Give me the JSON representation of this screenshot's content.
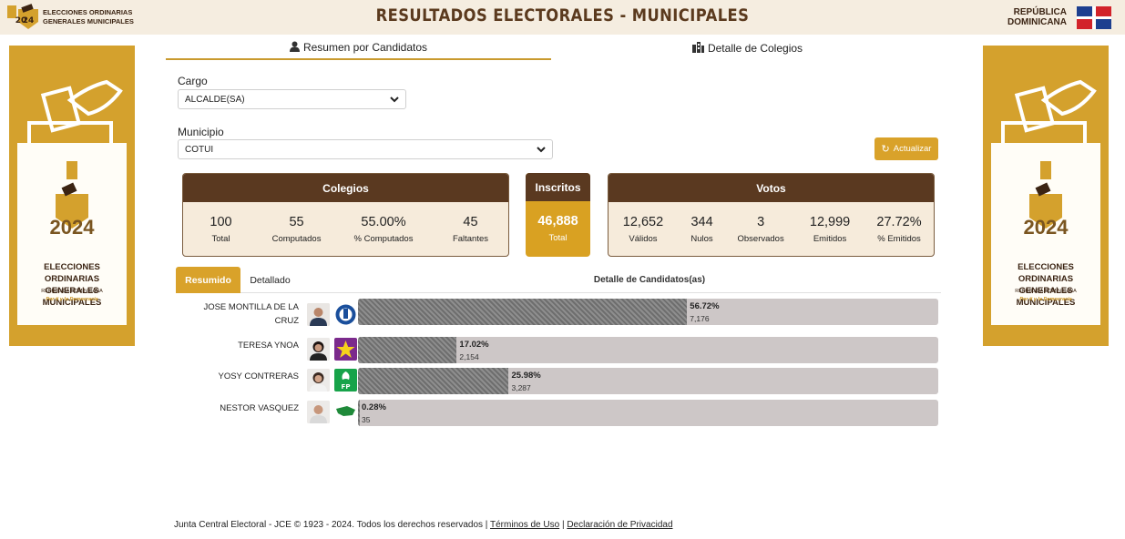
{
  "header": {
    "logo_year": "2024",
    "logo_text_1": "ELECCIONES ORDINARIAS",
    "logo_text_2": "GENERALES MUNICIPALES",
    "title": "RESULTADOS ELECTORALES - MUNICIPALES",
    "country_1": "REPÚBLICA",
    "country_2": "DOMINICANA"
  },
  "banner": {
    "year": "2024",
    "line1": "ELECCIONES ORDINARIAS",
    "line2": "GENERALES MUNICIPALES",
    "sub": "REPÚBLICA DOMINICANA",
    "slogan": "Por ti y la Democracia"
  },
  "tabs": {
    "resumen": "Resumen por Candidatos",
    "detalle": "Detalle de Colegios"
  },
  "filters": {
    "cargo_label": "Cargo",
    "cargo_value": "ALCALDE(SA)",
    "municipio_label": "Municipio",
    "municipio_value": "COTUI",
    "refresh_label": "Actualizar"
  },
  "colegios": {
    "title": "Colegios",
    "items": [
      {
        "value": "100",
        "label": "Total"
      },
      {
        "value": "55",
        "label": "Computados"
      },
      {
        "value": "55.00%",
        "label": "% Computados"
      },
      {
        "value": "45",
        "label": "Faltantes"
      }
    ]
  },
  "inscritos": {
    "title": "Inscritos",
    "value": "46,888",
    "label": "Total"
  },
  "votos": {
    "title": "Votos",
    "items": [
      {
        "value": "12,652",
        "label": "Válidos"
      },
      {
        "value": "344",
        "label": "Nulos"
      },
      {
        "value": "3",
        "label": "Observados"
      },
      {
        "value": "12,999",
        "label": "Emitidos"
      },
      {
        "value": "27.72%",
        "label": "% Emitidos"
      }
    ]
  },
  "results": {
    "tab_resumido": "Resumido",
    "tab_detallado": "Detallado",
    "heading": "Detalle de Candidatos(as)",
    "candidates": [
      {
        "name": "JOSE MONTILLA DE LA CRUZ",
        "percent_label": "56.72%",
        "votes": "7,176",
        "percent": 56.72,
        "party_color": "#1a4f9c"
      },
      {
        "name": "TERESA YNOA",
        "percent_label": "17.02%",
        "votes": "2,154",
        "percent": 17.02,
        "party_color": "#7b2a8c"
      },
      {
        "name": "YOSY CONTRERAS",
        "percent_label": "25.98%",
        "votes": "3,287",
        "percent": 25.98,
        "party_color": "#17a34a"
      },
      {
        "name": "NESTOR VASQUEZ",
        "percent_label": "0.28%",
        "votes": "35",
        "percent": 0.28,
        "party_color": "#1f8a3a"
      }
    ]
  },
  "footer": {
    "text": "Junta Central Electoral - JCE © 1923 - 2024. Todos los derechos reservados |",
    "terms": "Términos de Uso",
    "sep": "|",
    "privacy": "Declaración de Privacidad"
  },
  "colors": {
    "accent": "#d9a22a",
    "brown": "#5a3920",
    "header_bg": "#f5ede0"
  }
}
